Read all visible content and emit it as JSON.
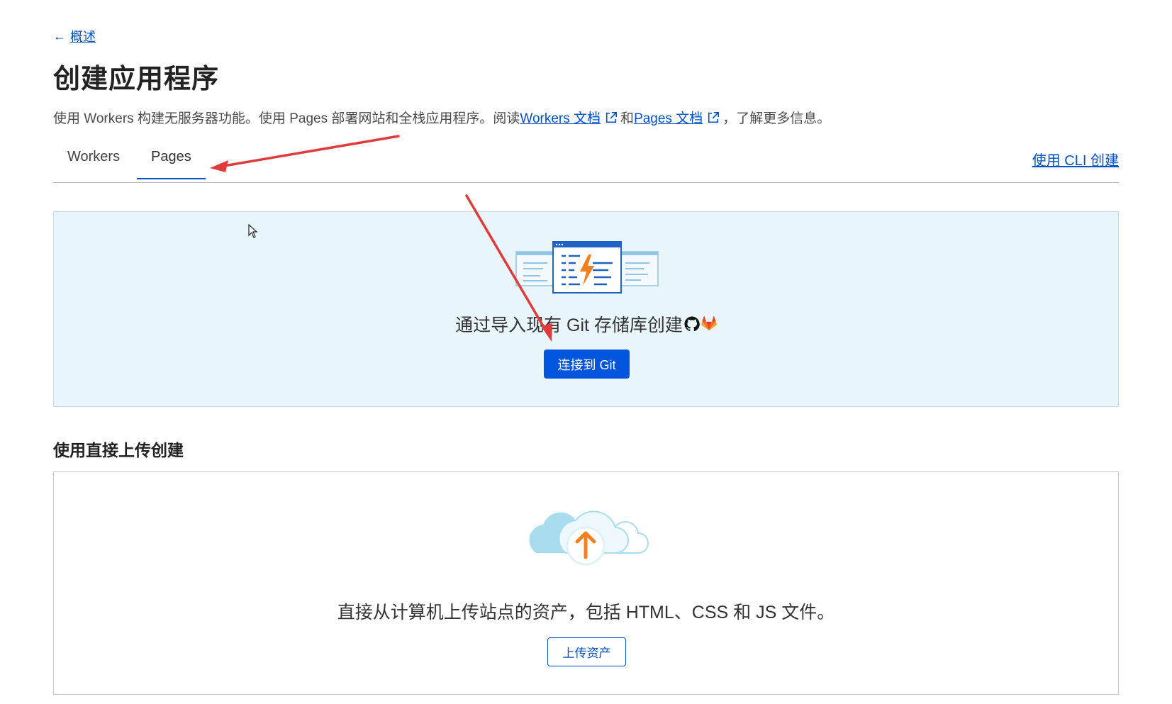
{
  "nav": {
    "back_label": "概述"
  },
  "page": {
    "title": "创建应用程序"
  },
  "description": {
    "text_1": "使用 Workers 构建无服务器功能。使用 Pages 部署网站和全栈应用程序。阅读 ",
    "workers_doc_link": "Workers 文档",
    "text_2": "和 ",
    "pages_doc_link": "Pages 文档",
    "text_3": "，了解更多信息。"
  },
  "tabs": [
    {
      "label": "Workers",
      "active": false
    },
    {
      "label": "Pages",
      "active": true
    }
  ],
  "cli_link": "使用 CLI 创建",
  "git_section": {
    "text": "通过导入现有 Git 存储库创建",
    "button_label": "连接到 Git"
  },
  "upload_section": {
    "title": "使用直接上传创建",
    "text": "直接从计算机上传站点的资产，包括 HTML、CSS 和 JS 文件。",
    "button_label": "上传资产"
  },
  "colors": {
    "link": "#0051c3",
    "primary_button": "#0055dc",
    "git_card_bg": "#e8f5fa",
    "annotation_arrow": "#e03a3a"
  },
  "icons": [
    "arrow-left-icon",
    "external-link-icon",
    "github-icon",
    "gitlab-icon",
    "cursor-icon"
  ]
}
